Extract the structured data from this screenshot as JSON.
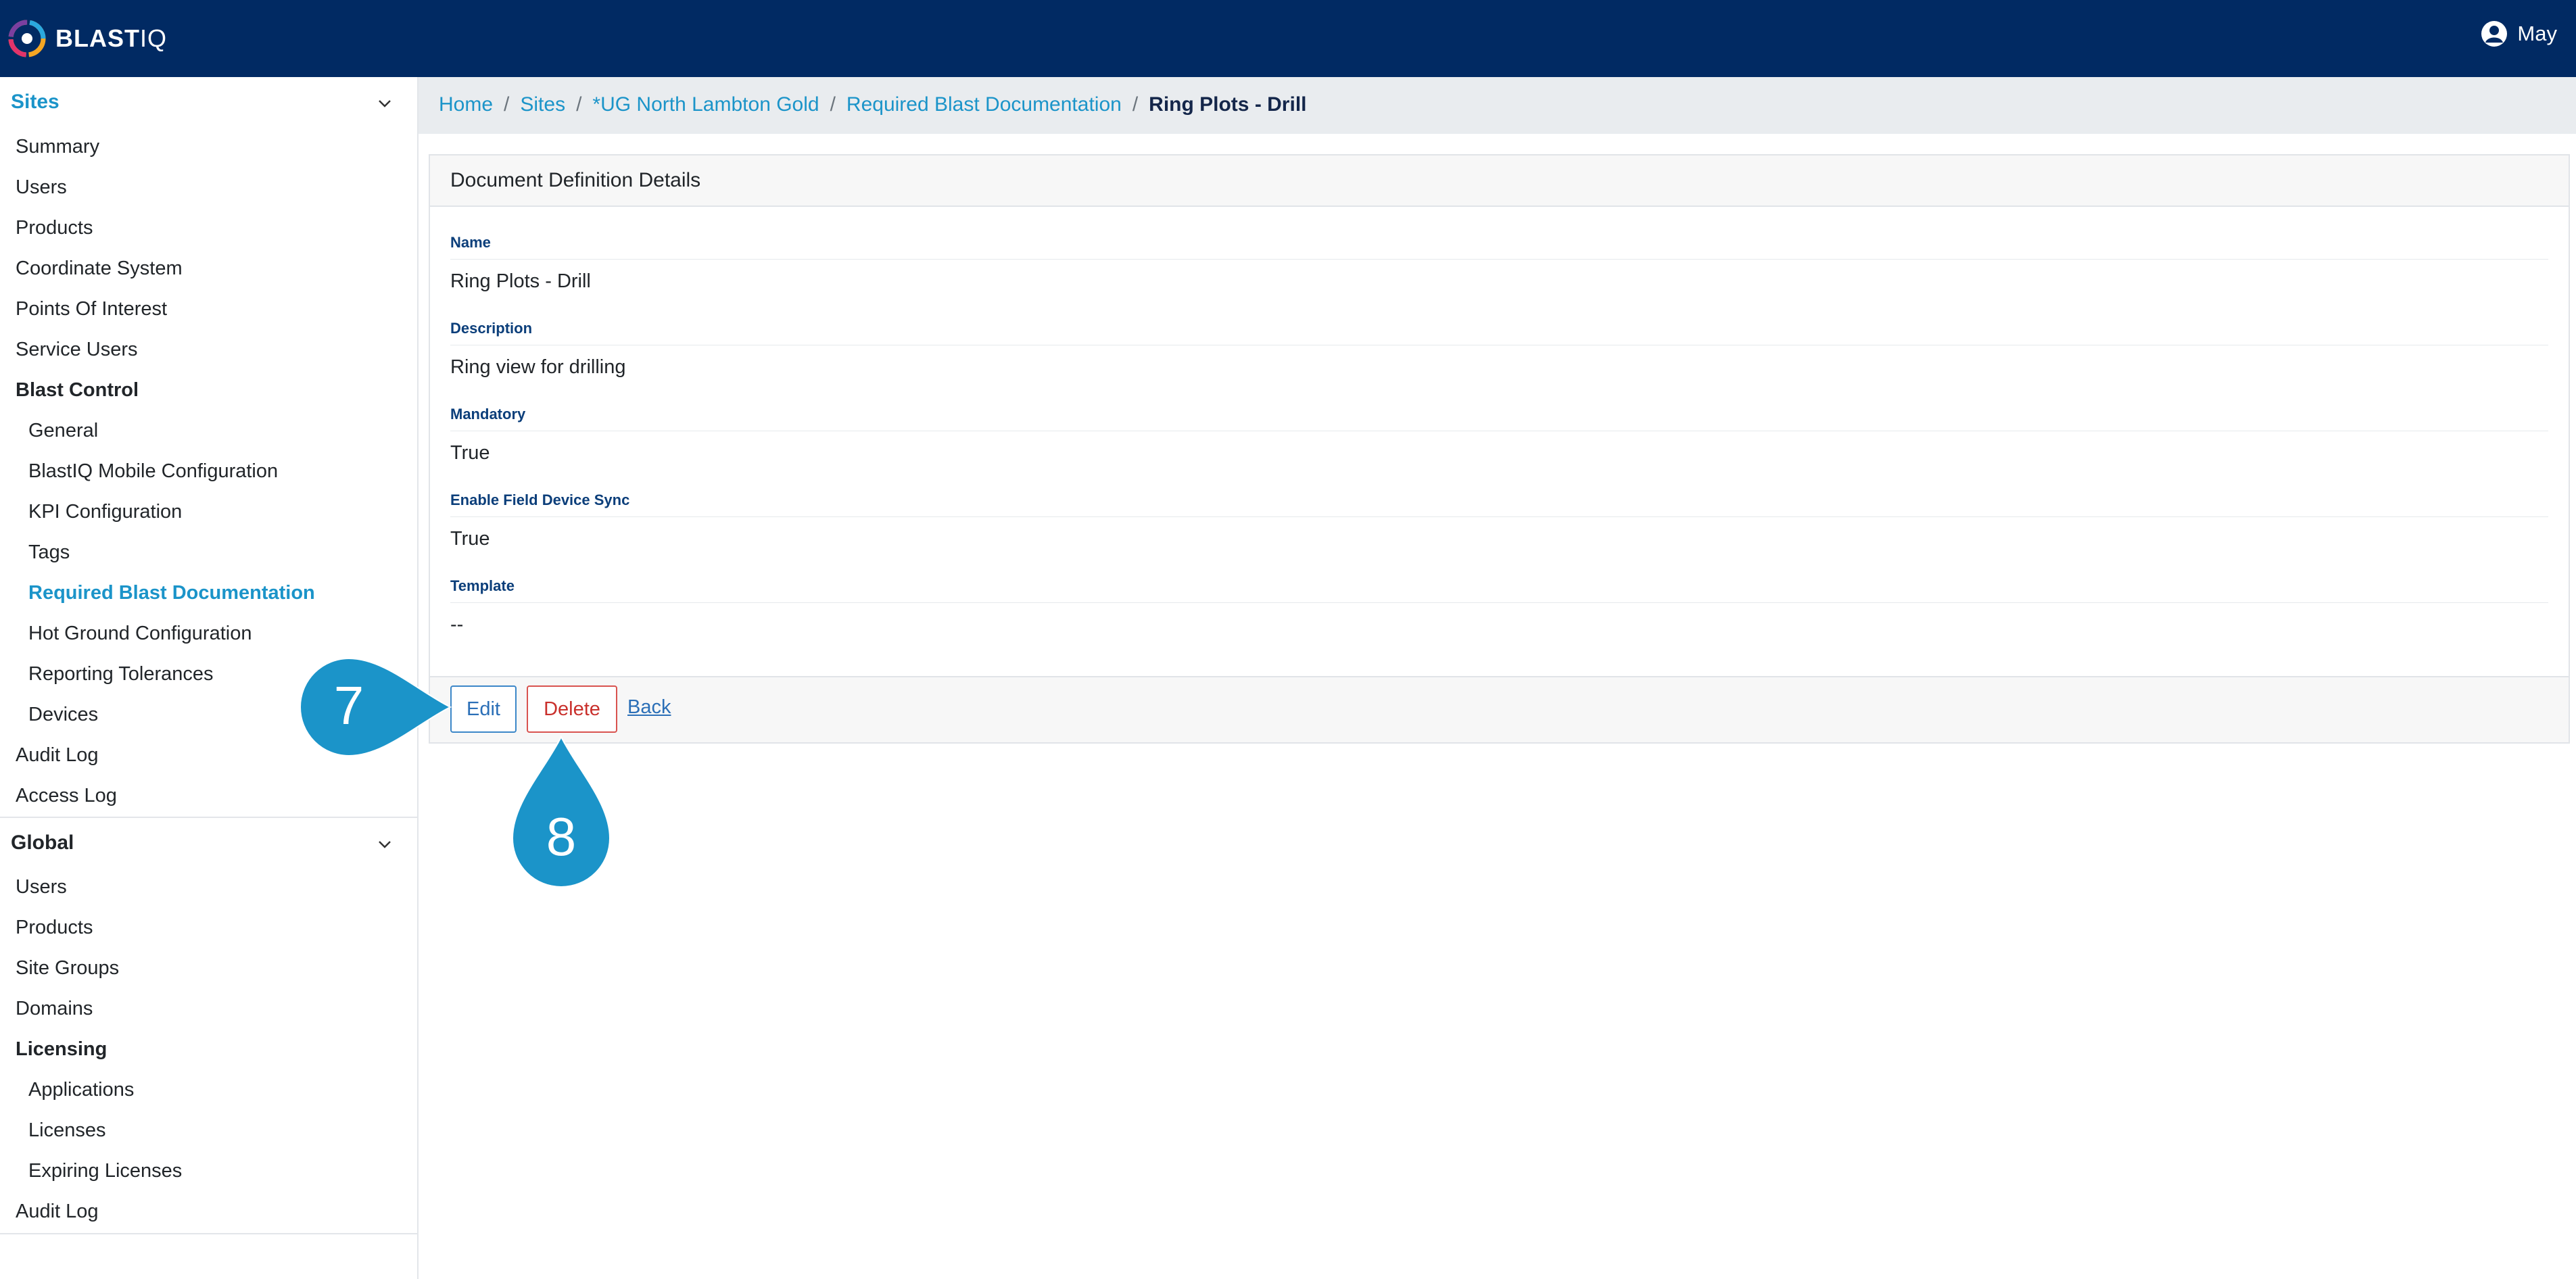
{
  "header": {
    "logo_text": "BLAST",
    "logo_text_suffix": "IQ",
    "user_name": "May",
    "colors": {
      "bar": "#012a63",
      "accent": "#1b94c9"
    }
  },
  "sidebar": {
    "sites": {
      "title": "Sites",
      "items": [
        {
          "label": "Summary",
          "level": 1
        },
        {
          "label": "Users",
          "level": 1
        },
        {
          "label": "Products",
          "level": 1
        },
        {
          "label": "Coordinate System",
          "level": 1
        },
        {
          "label": "Points Of Interest",
          "level": 1
        },
        {
          "label": "Service Users",
          "level": 1
        },
        {
          "label": "Blast Control",
          "level": 1,
          "bold": true
        },
        {
          "label": "General",
          "level": 2
        },
        {
          "label": "BlastIQ Mobile Configuration",
          "level": 2
        },
        {
          "label": "KPI Configuration",
          "level": 2
        },
        {
          "label": "Tags",
          "level": 2
        },
        {
          "label": "Required Blast Documentation",
          "level": 2,
          "active": true
        },
        {
          "label": "Hot Ground Configuration",
          "level": 2
        },
        {
          "label": "Reporting Tolerances",
          "level": 2
        },
        {
          "label": "Devices",
          "level": 2
        },
        {
          "label": "Audit Log",
          "level": 1
        },
        {
          "label": "Access Log",
          "level": 1
        }
      ]
    },
    "global": {
      "title": "Global",
      "items": [
        {
          "label": "Users",
          "level": 1
        },
        {
          "label": "Products",
          "level": 1
        },
        {
          "label": "Site Groups",
          "level": 1
        },
        {
          "label": "Domains",
          "level": 1
        },
        {
          "label": "Licensing",
          "level": 1,
          "bold": true
        },
        {
          "label": "Applications",
          "level": 2
        },
        {
          "label": "Licenses",
          "level": 2
        },
        {
          "label": "Expiring Licenses",
          "level": 2
        },
        {
          "label": "Audit Log",
          "level": 1
        }
      ]
    }
  },
  "breadcrumb": {
    "items": [
      "Home",
      "Sites",
      "*UG North Lambton Gold",
      "Required Blast Documentation"
    ],
    "current": "Ring Plots - Drill",
    "separator": "/"
  },
  "card": {
    "title": "Document Definition Details",
    "fields": [
      {
        "label": "Name",
        "value": "Ring Plots - Drill"
      },
      {
        "label": "Description",
        "value": "Ring view for drilling"
      },
      {
        "label": "Mandatory",
        "value": "True"
      },
      {
        "label": "Enable Field Device Sync",
        "value": "True"
      },
      {
        "label": "Template",
        "value": "--"
      }
    ],
    "edit_label": "Edit",
    "delete_label": "Delete",
    "back_label": "Back"
  },
  "callouts": [
    {
      "number": "7",
      "color": "#1b94c9"
    },
    {
      "number": "8",
      "color": "#1b94c9"
    }
  ]
}
